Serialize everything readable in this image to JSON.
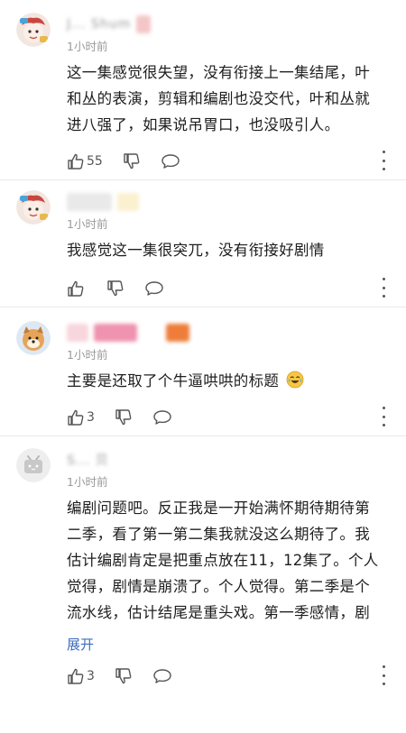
{
  "comments": [
    {
      "username": "J... Shum",
      "time": "1小时前",
      "text": "这一集感觉很失望，没有衔接上一集结尾，叶和丛的表演，剪辑和编剧也没交代，叶和丛就进八强了，如果说吊胃口，也没吸引人。",
      "like_count": "55",
      "avatar_icon": "cartoon-avatar"
    },
    {
      "username": "",
      "time": "1小时前",
      "text": "我感觉这一集很突兀，没有衔接好剧情",
      "like_count": "",
      "avatar_icon": "cartoon-avatar"
    },
    {
      "username": "",
      "time": "1小时前",
      "text": "主要是还取了个牛逼哄哄的标题",
      "like_count": "3",
      "avatar_icon": "dog-avatar",
      "emoji": "crying-laughing-emoji"
    },
    {
      "username": "S... 贝",
      "time": "1小时前",
      "text": "编剧问题吧。反正我是一开始满怀期待期待第二季，看了第一第二集我就没这么期待了。我估计编剧肯定是把重点放在11，12集了。个人觉得，剧情是崩溃了。个人觉得。第二季是个流水线，估计结尾是重头戏。第一季感情，剧情，人物刻画，情景，心理描写这些配合得很",
      "expand_label": "展开",
      "like_count": "3",
      "avatar_icon": "bilibili-tv-avatar"
    }
  ],
  "colors": {
    "text": "#1e1e1e",
    "meta": "#9a9a9a",
    "link": "#3d6ebd",
    "divider": "#e8e8e8"
  }
}
